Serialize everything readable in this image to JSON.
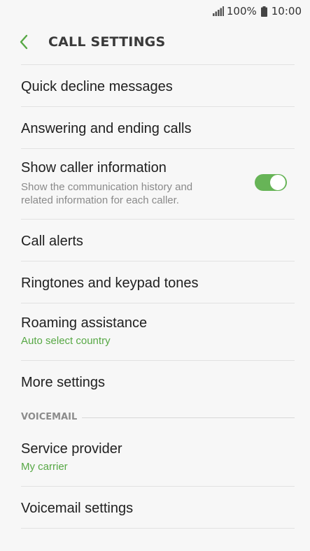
{
  "status_bar": {
    "battery_text": "100%",
    "time": "10:00",
    "icons": [
      "signal-icon",
      "battery-icon"
    ]
  },
  "header": {
    "title": "CALL SETTINGS",
    "back_icon": "chevron-left-icon",
    "accent_color": "#57a845"
  },
  "items": [
    {
      "label": "Quick decline messages"
    },
    {
      "label": "Answering and ending calls"
    },
    {
      "label": "Show caller information",
      "description": "Show the communication history and related information for each caller.",
      "toggle_on": true
    },
    {
      "label": "Call alerts"
    },
    {
      "label": "Ringtones and keypad tones"
    },
    {
      "label": "Roaming assistance",
      "sub": "Auto select country"
    },
    {
      "label": "More settings"
    }
  ],
  "voicemail": {
    "section_label": "VOICEMAIL",
    "items": [
      {
        "label": "Service provider",
        "sub": "My carrier"
      },
      {
        "label": "Voicemail settings"
      }
    ]
  }
}
